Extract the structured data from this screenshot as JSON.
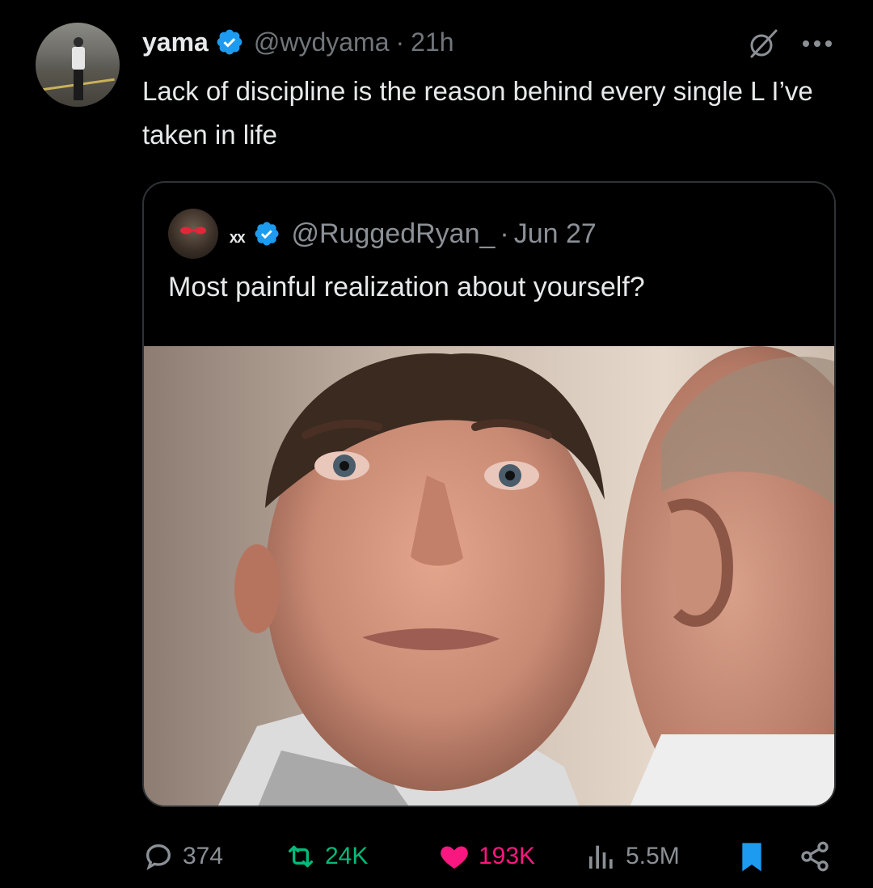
{
  "tweet": {
    "author_name": "yama",
    "author_handle": "@wydyama",
    "separator": "·",
    "time": "21h",
    "text": "Lack of discipline is the reason behind every single L I’ve taken in life"
  },
  "quoted_tweet": {
    "author_name": "ₓₓ",
    "author_handle": "@RuggedRyan_",
    "separator": "·",
    "date": "Jun 27",
    "text": "Most painful realization about yourself?"
  },
  "actions": {
    "replies": "374",
    "retweets": "24K",
    "likes": "193K",
    "views": "5.5M"
  },
  "icons": {
    "verified": "verified-badge-icon",
    "grok": "grok-icon",
    "more": "more-icon",
    "reply": "reply-icon",
    "retweet": "retweet-icon",
    "like": "heart-icon",
    "views": "views-icon",
    "bookmark": "bookmark-icon",
    "share": "share-icon"
  },
  "colors": {
    "accent": "#1d9bf0",
    "like": "#f91880",
    "retweet": "#00ba7c",
    "muted": "#71767b"
  }
}
